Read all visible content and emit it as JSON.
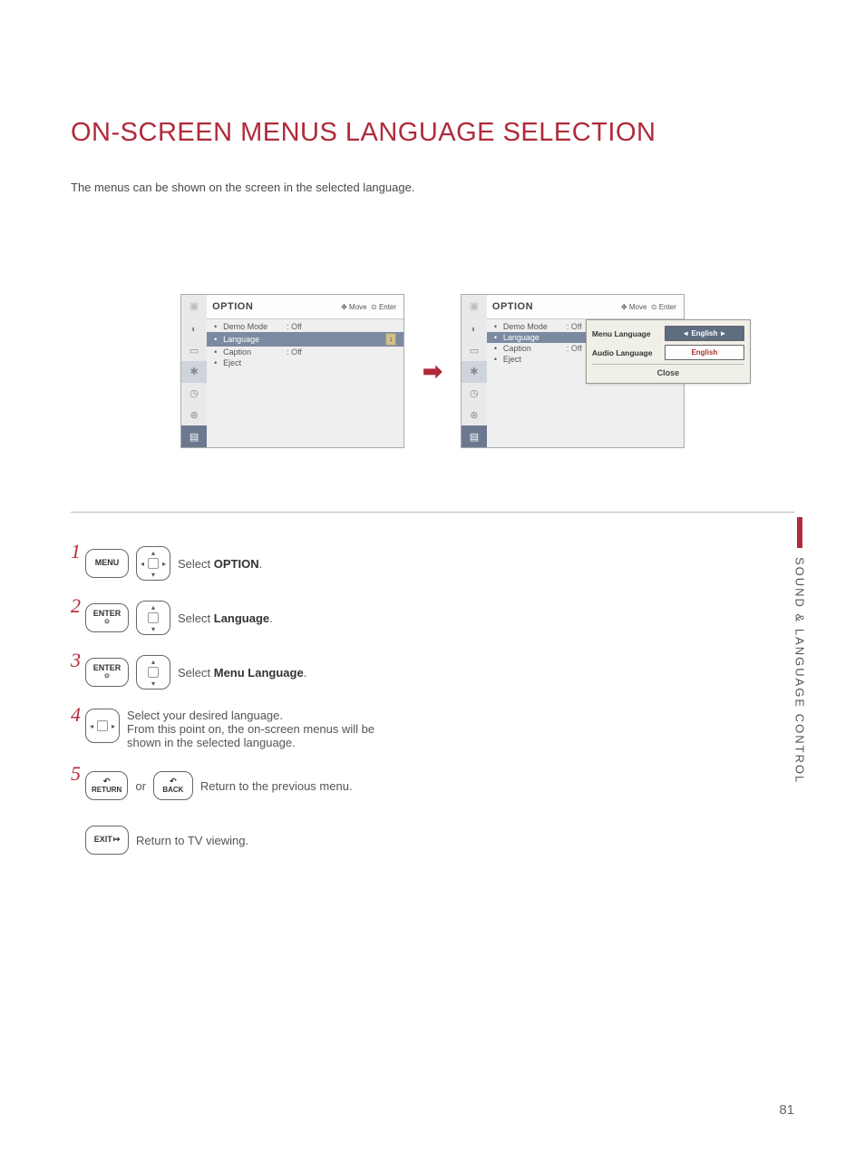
{
  "title": "ON-SCREEN MENUS LANGUAGE SELECTION",
  "subtitle": "The menus can be shown on the screen in the selected language.",
  "osd": {
    "header": "OPTION",
    "hint_move": "Move",
    "hint_enter": "Enter",
    "rows": [
      {
        "label": "Demo Mode",
        "value": ": Off"
      },
      {
        "label": "Language",
        "value": ""
      },
      {
        "label": "Caption",
        "value": ": Off"
      },
      {
        "label": "Eject",
        "value": ""
      }
    ]
  },
  "popup": {
    "menu_lang_label": "Menu Language",
    "menu_lang_value": "◄ English ►",
    "audio_lang_label": "Audio Language",
    "audio_lang_value": "English",
    "close": "Close"
  },
  "buttons": {
    "menu": "MENU",
    "enter": "ENTER",
    "return": "RETURN",
    "back": "BACK",
    "exit": "EXIT"
  },
  "steps": {
    "s1": {
      "pre": "Select ",
      "bold": "OPTION",
      "post": "."
    },
    "s2": {
      "pre": "Select ",
      "bold": "Language",
      "post": "."
    },
    "s3": {
      "pre": "Select ",
      "bold": "Menu Language",
      "post": "."
    },
    "s4a": "Select your desired language.",
    "s4b": "From this point on, the on-screen menus will be shown in the selected language.",
    "s5": "Return to the previous menu.",
    "s6": "Return to TV viewing."
  },
  "or": "or",
  "sidetab": "SOUND & LANGUAGE CONTROL",
  "page_number": "81"
}
